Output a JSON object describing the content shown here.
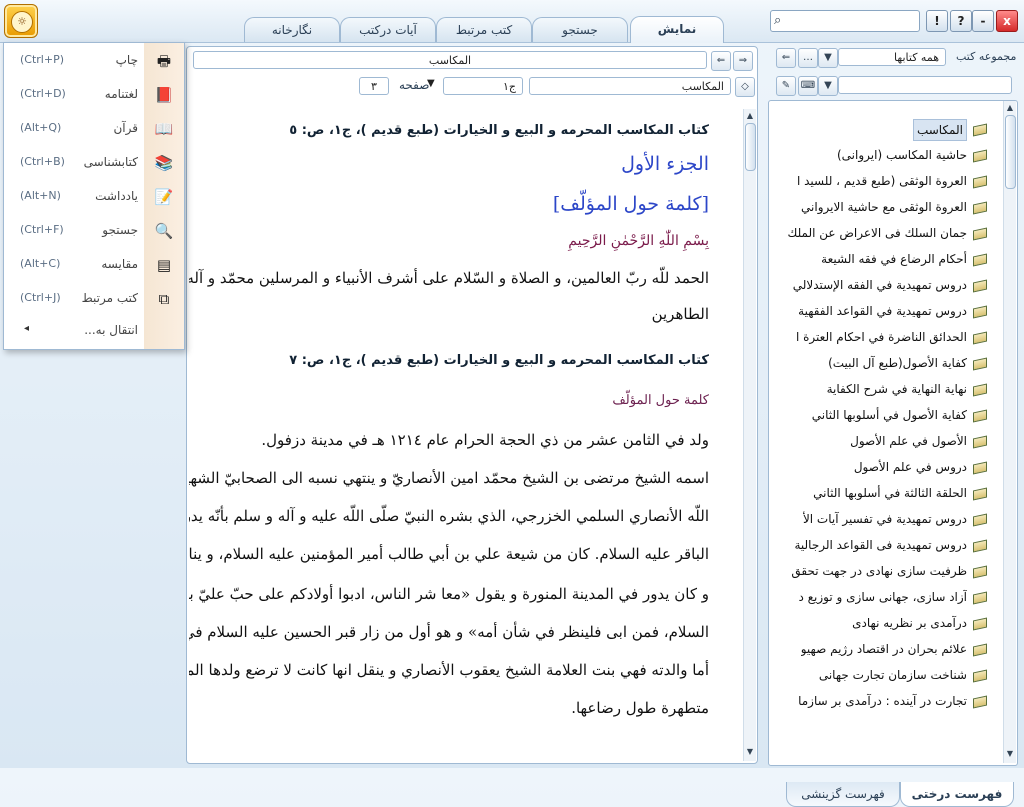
{
  "app": {
    "tabs": [
      "نمایش",
      "جستجو",
      "کتب مرتبط",
      "آیات درکتب",
      "نگارخانه"
    ],
    "window_buttons": [
      "!",
      "?",
      "-",
      "x"
    ],
    "search_placeholder": ""
  },
  "menu": {
    "items": [
      {
        "label": "چاپ",
        "shortcut": "(Ctrl+P)",
        "icon": "printer-icon",
        "glyph": "🖶"
      },
      {
        "label": "لغتنامه",
        "shortcut": "(Ctrl+D)",
        "icon": "dictionary-icon",
        "glyph": "📕"
      },
      {
        "label": "قرآن",
        "shortcut": "(Alt+Q)",
        "icon": "quran-icon",
        "glyph": "📖"
      },
      {
        "label": "کتابشناسی",
        "shortcut": "(Ctrl+B)",
        "icon": "bibliography-icon",
        "glyph": "📚"
      },
      {
        "label": "یادداشت",
        "shortcut": "(Alt+N)",
        "icon": "note-icon",
        "glyph": "📝"
      },
      {
        "label": "جستجو",
        "shortcut": "(Ctrl+F)",
        "icon": "search-icon",
        "glyph": "🔍"
      },
      {
        "label": "مقایسه",
        "shortcut": "(Alt+C)",
        "icon": "compare-icon",
        "glyph": "▤"
      },
      {
        "label": "کتب مرتبط",
        "shortcut": "(Ctrl+J)",
        "icon": "related-books-icon",
        "glyph": "⧉"
      }
    ],
    "more_label": "انتقال به...",
    "more_arrow": "◂"
  },
  "doc": {
    "title_field": "المكاسب",
    "book_field": "المكاسب",
    "volume_field": "ج١",
    "page_label": "صفحه",
    "page_value": "٣",
    "lines": [
      {
        "cls": "bhead",
        "text": "كتاب المكاسب المحرمه و البيع و الخيارات (طبع قديم )، ج‌١، ص: ٥"
      },
      {
        "cls": "chap",
        "text": "الجزء الأول"
      },
      {
        "cls": "chap",
        "text": "[كلمة حول المؤلّف]"
      },
      {
        "cls": "basm",
        "text": "بِسْمِ اللّٰهِ الرَّحْمٰنِ الرَّحِيمِ"
      },
      {
        "cls": "body",
        "text": "الحمد للّه ربّ العالمين، و الصلاة و السّلام على أشرف الأنبياء و المرسلين محمّد و آله"
      },
      {
        "cls": "body",
        "text": "الطاهرين"
      },
      {
        "cls": "bhead",
        "text": "كتاب المكاسب المحرمه و البيع و الخيارات (طبع قديم )، ج‌١، ص: ٧"
      },
      {
        "cls": "purp",
        "text": "كلمة حول المؤلّف"
      },
      {
        "cls": "body",
        "text": "ولد في الثامن عشر من ذي الحجة الحرام عام ١٢١٤ هـ في مدينة دزفول."
      },
      {
        "cls": "body",
        "text": "اسمه الشيخ مرتضى بن الشيخ محمّد امين الأنصاريّ و ينتهي نسبه الى الصحابيّ الشهير، جابر بن عبد"
      },
      {
        "cls": "body",
        "text": "اللّه الأنصاري السلمي الخزرجي، الذي بشره النبيّ صلّى اللّه عليه و آله و سلم بأنّه يدرك الإمام محمّد"
      },
      {
        "cls": "body",
        "text": "الباقر عليه السلام. كان من شيعة علي بن أبي طالب أمير المؤمنين عليه السلام، و ينادى بحبه و يتظاهر به"
      },
      {
        "cls": "body",
        "text": "و كان يدور في المدينة المنورة و يقول «معا شر الناس، ادبوا أولادكم على حبّ عليّ بن أبي طالب عليه"
      },
      {
        "cls": "body",
        "text": "السلام، فمن ابى فلينظر في شأن أمه» و هو أول من زار قبر الحسين عليه السلام في يوم الأربعين."
      },
      {
        "cls": "body",
        "text": "أما والدته فهي بنت العلامة الشيخ يعقوب الأنصاري و ينقل انها كانت لا ترضع ولدها المرتضى الا و هي"
      },
      {
        "cls": "body",
        "text": "متطهرة طول رضاعها."
      }
    ]
  },
  "right": {
    "collection_label": "مجموعه کتب",
    "collection_value": "همه کتابها",
    "tree_items": [
      "المكاسب",
      "حاشية المكاسب (ايروانى)",
      "العروة الوثقى (طبع قديم ، للسيد ا",
      "العروة الوثقى مع حاشية الايرواني",
      "جمان السلك فى الاعراض عن الملك",
      "أحكام الرضاع في فقه الشيعة",
      "دروس تمهيدية في الفقه الإستدلالي",
      "دروس تمهيدية في القواعد الفقهية",
      "الحدائق الناضرة في احكام العترة ا",
      "كفاية الأصول(طبع آل البيت)",
      "نهاية النهاية في شرح الكفاية",
      "كفاية الأصول في أسلوبها الثاني",
      "الأصول في علم الأصول",
      "دروس في علم الأصول",
      "الحلقة الثالثة في أسلوبها الثاني",
      "دروس تمهيدية في تفسير آيات الأ",
      "دروس تمهيدية فى القواعد الرجالية",
      "ظرفيت سازى نهادى در جهت تحقق",
      "آزاد سازى، جهانى سازى و توزيع د",
      "درآمدى بر نظريه نهادى",
      "علائم بحران در اقتصاد رژيم صهيو",
      "شناخت سازمان تجارت جهانى",
      "تجارت در آينده : درآمدى بر سازما"
    ],
    "bottom_tabs": [
      "فهرست درختى",
      "فهرست گزينشى"
    ]
  },
  "colors": {
    "accent": "#2c46c8",
    "purple": "#6b1f4e",
    "border": "#9fb9d3",
    "logo": "#f0a800"
  }
}
